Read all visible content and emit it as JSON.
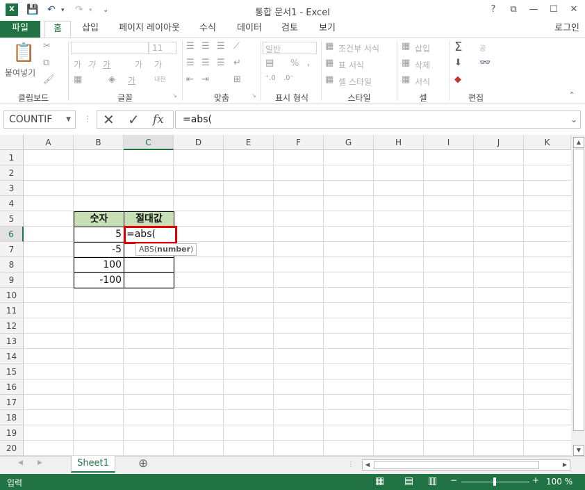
{
  "title": "통합 문서1 - Excel",
  "titlebar_buttons": {
    "help": "?",
    "restore_ribbon": "⧉",
    "minimize": "—",
    "maximize": "☐",
    "close": "✕"
  },
  "tabs": [
    {
      "label": "파일"
    },
    {
      "label": "홈"
    },
    {
      "label": "삽입"
    },
    {
      "label": "페이지 레이아웃"
    },
    {
      "label": "수식"
    },
    {
      "label": "데이터"
    },
    {
      "label": "검토"
    },
    {
      "label": "보기"
    }
  ],
  "signin": "로그인",
  "ribbon": {
    "clipboard": {
      "paste": "붙여넣기",
      "label": "클립보드"
    },
    "font": {
      "size": "11",
      "bold": "가",
      "italic": "가",
      "underline": "가",
      "grow": "가",
      "shrink": "가",
      "fontcolor": "가",
      "phonetic": "내천",
      "label": "글꼴"
    },
    "alignment": {
      "label": "맞춤"
    },
    "number": {
      "format": "일반",
      "percent": "%",
      "label": "표시 형식"
    },
    "styles": {
      "conditional": "조건부 서식",
      "table": "표 서식",
      "cell": "셀 스타일",
      "label": "스타일"
    },
    "cells": {
      "insert": "삽입",
      "delete": "삭제",
      "format": "서식",
      "label": "셀"
    },
    "editing": {
      "sort": "공",
      "label": "편집"
    }
  },
  "formula_bar": {
    "name_box": "COUNTIF",
    "formula": "=abs(",
    "cancel": "✕",
    "enter": "✓",
    "fx": "fx"
  },
  "columns": [
    "A",
    "B",
    "C",
    "D",
    "E",
    "F",
    "G",
    "H",
    "I",
    "J",
    "K"
  ],
  "rows": [
    "1",
    "2",
    "3",
    "4",
    "5",
    "6",
    "7",
    "8",
    "9",
    "10",
    "11",
    "12",
    "13",
    "14",
    "15",
    "16",
    "17",
    "18",
    "19",
    "20"
  ],
  "cells": {
    "B5": "숫자",
    "C5": "절대값",
    "B6": "5",
    "C6": "=abs(",
    "B7": "-5",
    "B8": "100",
    "B9": "-100"
  },
  "tooltip": {
    "func": "ABS(",
    "arg": "number",
    "close": ")"
  },
  "sheets": [
    {
      "name": "Sheet1"
    }
  ],
  "add_sheet": "⊕",
  "status": {
    "mode": "입력",
    "zoom": "100 %"
  },
  "colors": {
    "accent": "#217346",
    "header_fill": "#c6e0b4",
    "active_border": "#e00000"
  }
}
